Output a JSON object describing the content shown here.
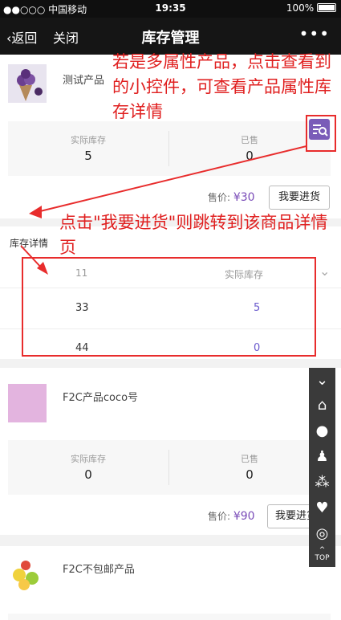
{
  "status_bar": {
    "carrier": "●●○○○ 中国移动",
    "time": "19:35",
    "battery": "100%"
  },
  "nav": {
    "back_label": "返回",
    "close_label": "关闭",
    "title": "库存管理",
    "more": "•••"
  },
  "products": [
    {
      "name": "测试产品",
      "stat1_label": "实际库存",
      "stat1_value": "5",
      "stat2_label": "已售",
      "stat2_value": "0",
      "price_label": "售价: ",
      "price": "¥30",
      "button": "我要进货"
    },
    {
      "name": "F2C产品coco号",
      "stat1_label": "实际库存",
      "stat1_value": "0",
      "stat2_label": "已售",
      "stat2_value": "0",
      "price_label": "售价: ",
      "price": "¥90",
      "button": "我要进货"
    },
    {
      "name": "F2C不包邮产品"
    }
  ],
  "detail": {
    "title": "库存详情",
    "col1": "11",
    "col2": "实际库存",
    "rows": [
      {
        "a": "33",
        "b": "5"
      },
      {
        "a": "44",
        "b": "0"
      }
    ]
  },
  "annotations": {
    "top": "若是多属性产品，点击查看到的小控件，可查看产品属性库存详情",
    "mid": "点击\"我要进货\"则跳转到该商品详情页"
  },
  "sidebar": {
    "top_label": "TOP"
  }
}
